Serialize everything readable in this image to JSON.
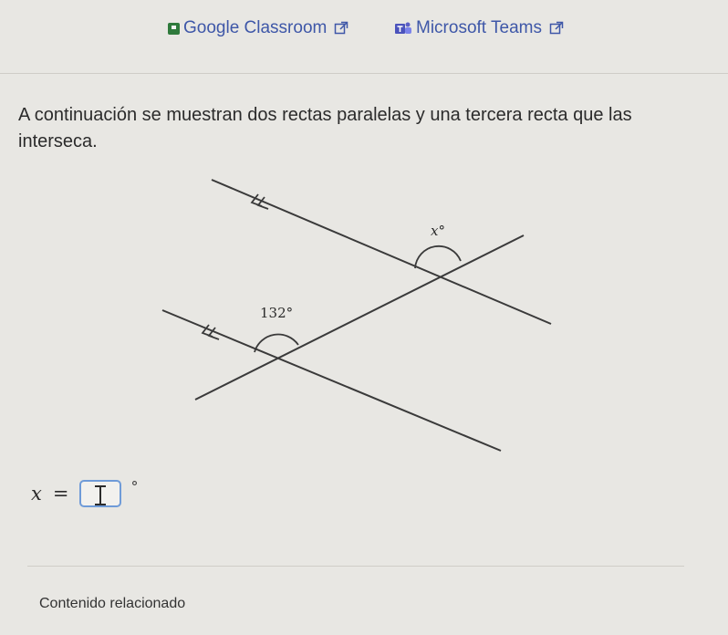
{
  "share": {
    "classroom_label": "Google Classroom",
    "teams_label": "Microsoft Teams"
  },
  "question": {
    "text": "A continuación se muestran dos rectas paralelas y una tercera recta que las interseca."
  },
  "diagram": {
    "known_angle_label": "132°",
    "unknown_angle_label": "x°"
  },
  "answer": {
    "variable": "x",
    "equals": "=",
    "value": "",
    "unit": "°"
  },
  "footer": {
    "related_label": "Contenido relacionado"
  },
  "colors": {
    "link": "#3e57a8",
    "input_border": "#6f9bd8",
    "background": "#e8e7e3"
  }
}
